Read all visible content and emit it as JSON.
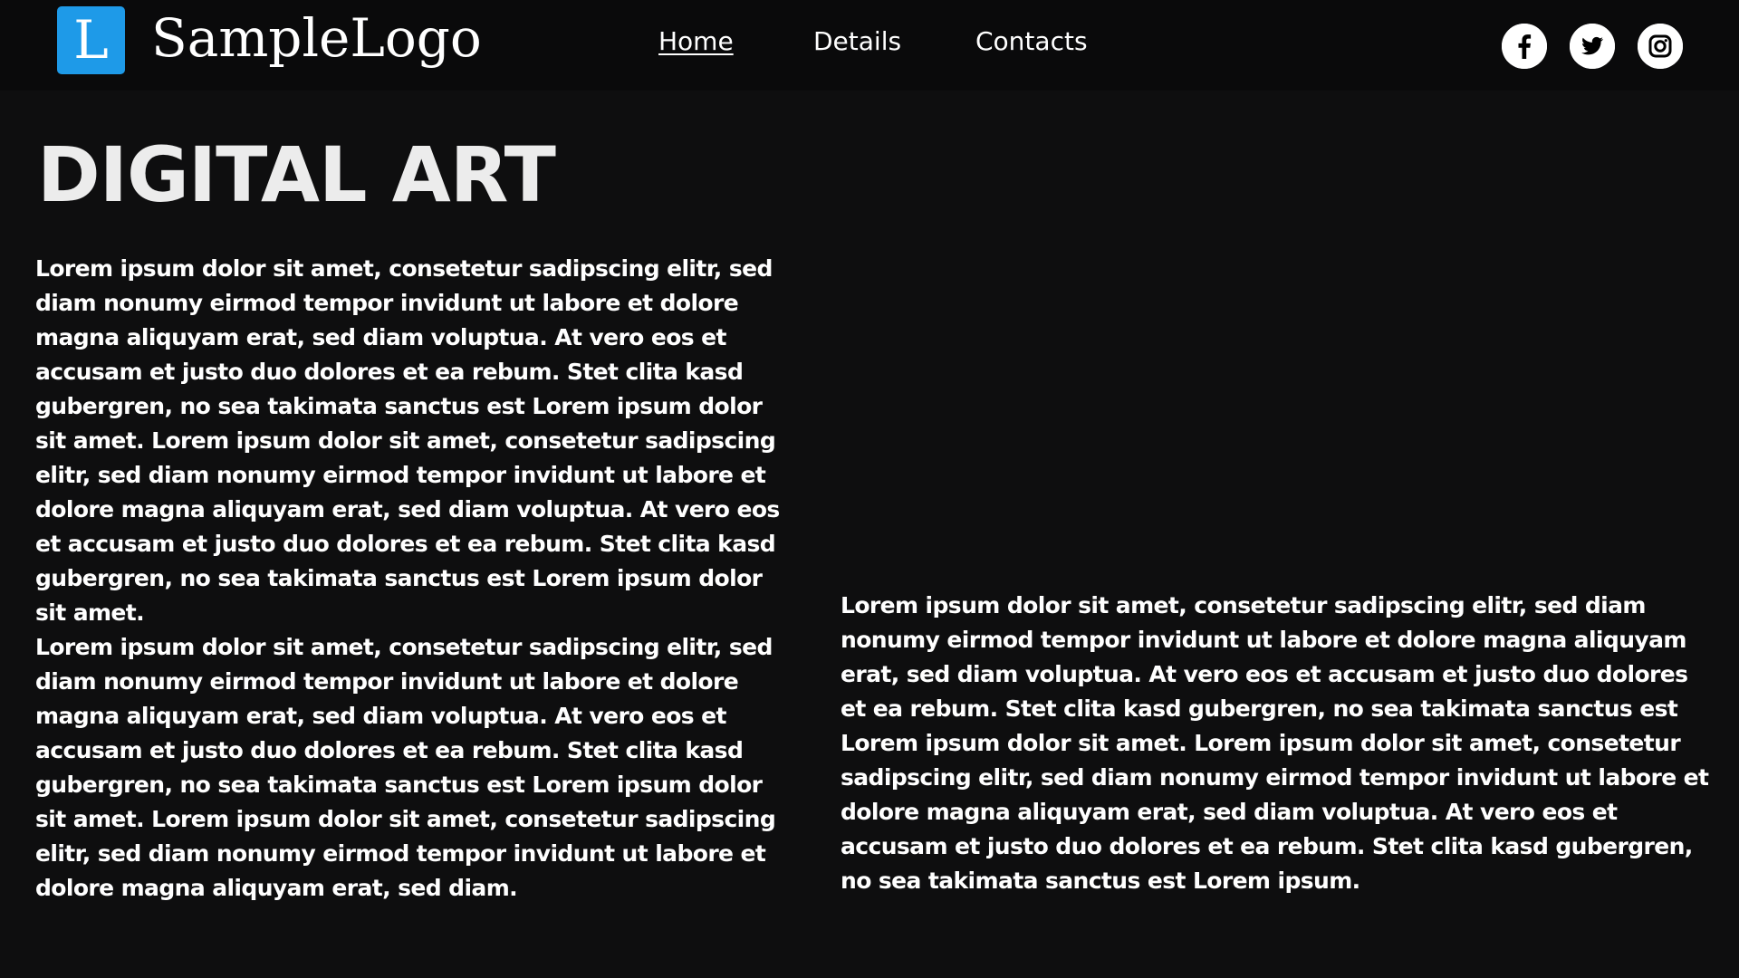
{
  "header": {
    "logo_letter": "L",
    "logo_text": "SampleLogo",
    "nav": [
      {
        "label": "Home",
        "active": true
      },
      {
        "label": "Details",
        "active": false
      },
      {
        "label": "Contacts",
        "active": false
      }
    ],
    "social": [
      "facebook-icon",
      "twitter-icon",
      "instagram-icon"
    ]
  },
  "main": {
    "title": "DIGITAL ART",
    "left_paragraphs": [
      "Lorem ipsum dolor sit amet, consetetur sadipscing elitr, sed diam nonumy eirmod tempor invidunt ut labore et dolore magna aliquyam erat, sed diam voluptua. At vero eos et accusam et justo duo dolores et ea rebum. Stet clita kasd gubergren, no sea takimata sanctus est Lorem ipsum dolor sit amet. Lorem ipsum dolor sit amet, consetetur sadipscing elitr, sed diam nonumy eirmod tempor invidunt ut labore et dolore magna aliquyam erat, sed diam voluptua. At vero eos et accusam et justo duo dolores et ea rebum. Stet clita kasd gubergren, no sea takimata sanctus est Lorem ipsum dolor sit amet.",
      "Lorem ipsum dolor sit amet, consetetur sadipscing elitr, sed diam nonumy eirmod tempor invidunt ut labore et dolore magna aliquyam erat, sed diam voluptua. At vero eos et accusam et justo duo dolores et ea rebum. Stet clita kasd gubergren, no sea takimata sanctus est Lorem ipsum dolor sit amet. Lorem ipsum dolor sit amet, consetetur sadipscing elitr, sed diam nonumy eirmod tempor invidunt ut labore et dolore magna aliquyam erat, sed diam."
    ],
    "right_paragraph": "Lorem ipsum dolor sit amet, consetetur sadipscing elitr, sed diam nonumy eirmod tempor invidunt ut labore et dolore magna aliquyam erat, sed diam voluptua. At vero eos et accusam et justo duo dolores et ea rebum. Stet clita kasd gubergren, no sea takimata sanctus est Lorem ipsum dolor sit amet. Lorem ipsum dolor sit amet, consetetur sadipscing elitr, sed diam nonumy eirmod tempor invidunt ut labore et dolore magna aliquyam erat, sed diam voluptua. At vero eos et accusam et justo duo dolores et ea rebum. Stet clita kasd gubergren, no sea takimata sanctus est Lorem ipsum."
  },
  "colors": {
    "background": "#0e0e0f",
    "header_background": "#0a0a0b",
    "logo_accent": "#1e9ae8",
    "text": "#ffffff"
  }
}
